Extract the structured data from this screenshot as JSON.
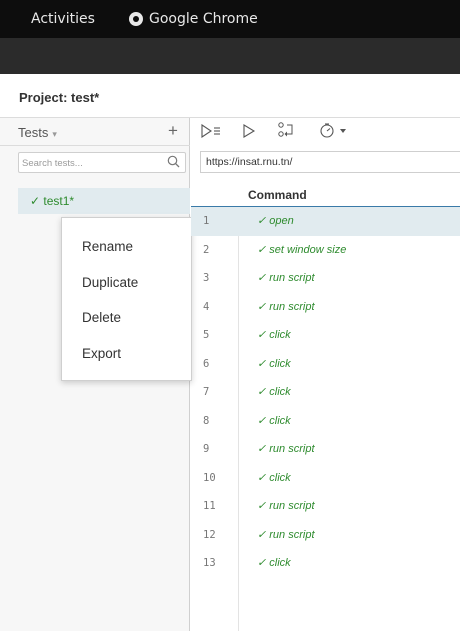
{
  "system_bar": {
    "activities": "Activities",
    "app_name": "Google Chrome"
  },
  "project": {
    "label": "Project:",
    "name": "test*"
  },
  "sidebar": {
    "tests_title": "Tests",
    "tests_caret": "▾",
    "add_label": "+",
    "search_placeholder": "Search tests...",
    "tests": [
      {
        "label": "✓ test1*",
        "selected": true
      }
    ]
  },
  "context_menu": {
    "items": [
      "Rename",
      "Duplicate",
      "Delete",
      "Export"
    ]
  },
  "toolbar": {
    "icons": [
      "run-all-icon",
      "run-icon",
      "step-icon",
      "speed-icon"
    ]
  },
  "url": {
    "value": "https://insat.rnu.tn/"
  },
  "grid": {
    "header": "Command",
    "rows": [
      {
        "num": "1",
        "command": "✓ open",
        "selected": true
      },
      {
        "num": "2",
        "command": "✓ set window size"
      },
      {
        "num": "3",
        "command": "✓ run script"
      },
      {
        "num": "4",
        "command": "✓ run script"
      },
      {
        "num": "5",
        "command": "✓ click"
      },
      {
        "num": "6",
        "command": "✓ click"
      },
      {
        "num": "7",
        "command": "✓ click"
      },
      {
        "num": "8",
        "command": "✓ click"
      },
      {
        "num": "9",
        "command": "✓ run script"
      },
      {
        "num": "10",
        "command": "✓ click"
      },
      {
        "num": "11",
        "command": "✓ run script"
      },
      {
        "num": "12",
        "command": "✓ run script"
      },
      {
        "num": "13",
        "command": "✓ click"
      }
    ]
  },
  "colors": {
    "success": "#2e8b2e",
    "selected_row": "#e1ebef",
    "header_underline": "#3a7aa8"
  }
}
